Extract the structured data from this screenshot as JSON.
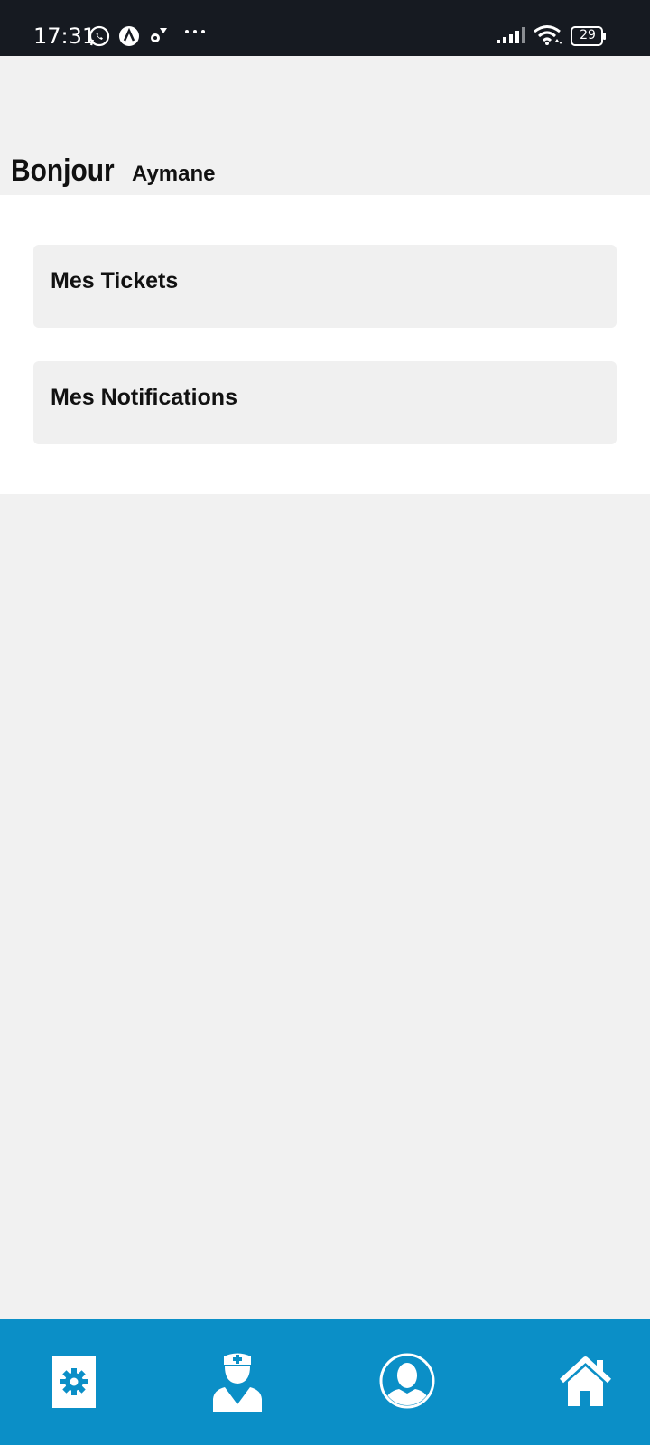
{
  "status_bar": {
    "time": "17:31",
    "battery": "29",
    "icons": [
      "whatsapp-icon",
      "a-app-icon",
      "settings-gear-icon",
      "more-dots-icon",
      "signal-icon",
      "wifi-icon",
      "battery-icon"
    ]
  },
  "greeting": {
    "hello": "Bonjour",
    "name": "Aymane"
  },
  "cards": [
    {
      "label": "Mes Tickets"
    },
    {
      "label": "Mes Notifications"
    }
  ],
  "bottom_nav": {
    "items": [
      "settings-icon",
      "doctor-icon",
      "profile-icon",
      "home-icon"
    ]
  },
  "colors": {
    "status_bar": "#161a21",
    "background": "#f1f1f1",
    "panel": "#ffffff",
    "card": "#f0f0f0",
    "nav": "#0b8fc7"
  }
}
